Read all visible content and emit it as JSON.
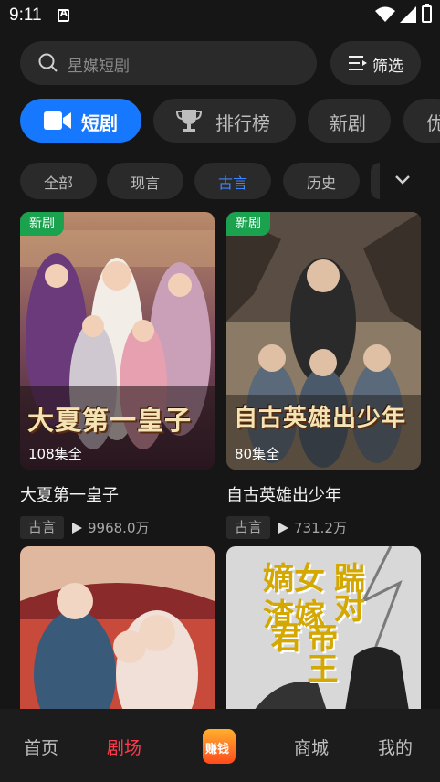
{
  "status_bar": {
    "time": "9:11"
  },
  "search": {
    "placeholder": "星媒短剧",
    "filter_label": "筛选"
  },
  "main_tabs": [
    {
      "label": "短剧",
      "icon": "video-camera-icon",
      "active": true
    },
    {
      "label": "排行榜",
      "icon": "trophy-icon",
      "active": false
    },
    {
      "label": "新剧",
      "active": false
    },
    {
      "label": "优",
      "active": false
    }
  ],
  "genre_chips": [
    {
      "label": "全部",
      "active": false
    },
    {
      "label": "现言",
      "active": false
    },
    {
      "label": "古言",
      "active": true
    },
    {
      "label": "历史",
      "active": false
    }
  ],
  "cards": [
    {
      "badge": "新剧",
      "episodes": "108集全",
      "poster_title": "大夏第一皇子",
      "name": "大夏第一皇子",
      "tag": "古言",
      "views": "9968.0万"
    },
    {
      "badge": "新剧",
      "episodes": "80集全",
      "poster_title": "自古英雄出少年",
      "name": "自古英雄出少年",
      "tag": "古言",
      "views": "731.2万"
    }
  ],
  "poster_row2": [
    {
      "description": "couple-romance"
    },
    {
      "poster_text": [
        "嫡女",
        "踹",
        "渣嫁",
        "对",
        "帝王君"
      ]
    }
  ],
  "bottom_nav": [
    {
      "label": "首页",
      "active": false
    },
    {
      "label": "剧场",
      "active": true
    },
    {
      "label": "赚钱",
      "active": false
    },
    {
      "label": "商城",
      "active": false
    },
    {
      "label": "我的",
      "active": false
    }
  ],
  "colors": {
    "accent_blue": "#1677ff",
    "active_red": "#ff3b4a",
    "badge_green": "#1aa24f",
    "background": "#161616"
  }
}
